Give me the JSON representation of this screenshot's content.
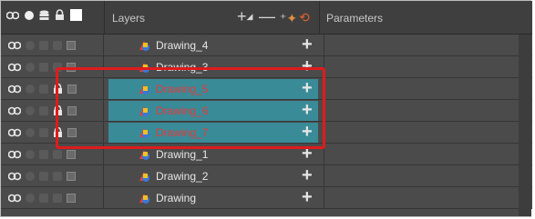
{
  "header": {
    "layers_label": "Layers",
    "parameters_label": "Parameters"
  },
  "icons": {
    "onion": "onion-skin-icon",
    "dot": "visibility-dot-icon",
    "stack": "stack-icon",
    "lock": "lock-icon",
    "color": "color-swatch-icon",
    "add": "add-layer-icon",
    "remove": "remove-layer-icon",
    "add_peg": "add-peg-icon",
    "add_deformer": "add-deformer-icon"
  },
  "colors": {
    "panel_bg": "#4b4b4b",
    "selection_bg": "#3a8b98",
    "selected_text": "#e53a3a",
    "highlight_border": "#e01b1b"
  },
  "layers": [
    {
      "name": "Drawing_4",
      "selected": false,
      "locked": false
    },
    {
      "name": "Drawing_3",
      "selected": false,
      "locked": false
    },
    {
      "name": "Drawing_5",
      "selected": true,
      "locked": true
    },
    {
      "name": "Drawing_6",
      "selected": true,
      "locked": true
    },
    {
      "name": "Drawing_7",
      "selected": true,
      "locked": true
    },
    {
      "name": "Drawing_1",
      "selected": false,
      "locked": false
    },
    {
      "name": "Drawing_2",
      "selected": false,
      "locked": false
    },
    {
      "name": "Drawing",
      "selected": false,
      "locked": false
    }
  ]
}
